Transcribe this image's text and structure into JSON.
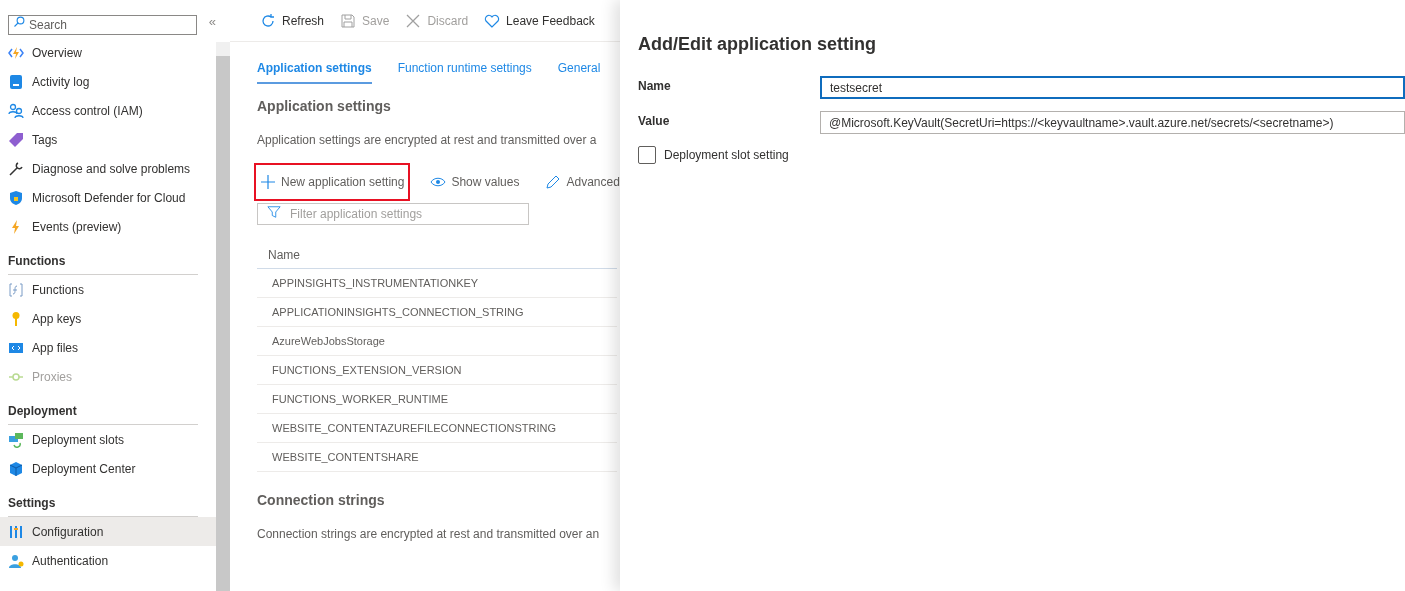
{
  "sidebar": {
    "search": {
      "placeholder": "Search"
    },
    "collapse": "«",
    "sections": [
      {
        "items": [
          {
            "label": "Overview",
            "selected": false,
            "disabled": false
          },
          {
            "label": "Activity log",
            "selected": false,
            "disabled": false
          },
          {
            "label": "Access control (IAM)",
            "selected": false,
            "disabled": false
          },
          {
            "label": "Tags",
            "selected": false,
            "disabled": false
          },
          {
            "label": "Diagnose and solve problems",
            "selected": false,
            "disabled": false
          },
          {
            "label": "Microsoft Defender for Cloud",
            "selected": false,
            "disabled": false
          },
          {
            "label": "Events (preview)",
            "selected": false,
            "disabled": false
          }
        ]
      },
      {
        "heading": "Functions",
        "items": [
          {
            "label": "Functions",
            "selected": false,
            "disabled": false
          },
          {
            "label": "App keys",
            "selected": false,
            "disabled": false
          },
          {
            "label": "App files",
            "selected": false,
            "disabled": false
          },
          {
            "label": "Proxies",
            "selected": false,
            "disabled": true
          }
        ]
      },
      {
        "heading": "Deployment",
        "items": [
          {
            "label": "Deployment slots",
            "selected": false,
            "disabled": false
          },
          {
            "label": "Deployment Center",
            "selected": false,
            "disabled": false
          }
        ]
      },
      {
        "heading": "Settings",
        "items": [
          {
            "label": "Configuration",
            "selected": true,
            "disabled": false
          },
          {
            "label": "Authentication",
            "selected": false,
            "disabled": false
          }
        ]
      }
    ]
  },
  "toolbar": [
    {
      "label": "Refresh",
      "disabled": false
    },
    {
      "label": "Save",
      "disabled": true
    },
    {
      "label": "Discard",
      "disabled": true
    },
    {
      "label": "Leave Feedback",
      "disabled": false
    }
  ],
  "tabs": [
    {
      "label": "Application settings",
      "selected": true
    },
    {
      "label": "Function runtime settings",
      "selected": false
    },
    {
      "label": "General",
      "selected": false
    }
  ],
  "app_settings": {
    "title": "Application settings",
    "description": "Application settings are encrypted at rest and transmitted over a",
    "commands": [
      {
        "label": "New application setting",
        "highlighted": true
      },
      {
        "label": "Show values",
        "highlighted": false
      },
      {
        "label": "Advanced",
        "highlighted": false
      }
    ],
    "filter": {
      "placeholder": "Filter application settings"
    },
    "table": {
      "columns": [
        "Name"
      ],
      "rows": [
        "APPINSIGHTS_INSTRUMENTATIONKEY",
        "APPLICATIONINSIGHTS_CONNECTION_STRING",
        "AzureWebJobsStorage",
        "FUNCTIONS_EXTENSION_VERSION",
        "FUNCTIONS_WORKER_RUNTIME",
        "WEBSITE_CONTENTAZUREFILECONNECTIONSTRING",
        "WEBSITE_CONTENTSHARE"
      ]
    }
  },
  "connection_strings": {
    "title": "Connection strings",
    "description": "Connection strings are encrypted at rest and transmitted over an"
  },
  "panel": {
    "title": "Add/Edit application setting",
    "fields": [
      {
        "label": "Name",
        "value": "testsecret",
        "focused": true
      },
      {
        "label": "Value",
        "value": "@Microsoft.KeyVault(SecretUri=https://<keyvaultname>.vault.azure.net/secrets/<secretname>)",
        "focused": false
      }
    ],
    "checkbox": {
      "label": "Deployment slot setting",
      "checked": false
    }
  }
}
